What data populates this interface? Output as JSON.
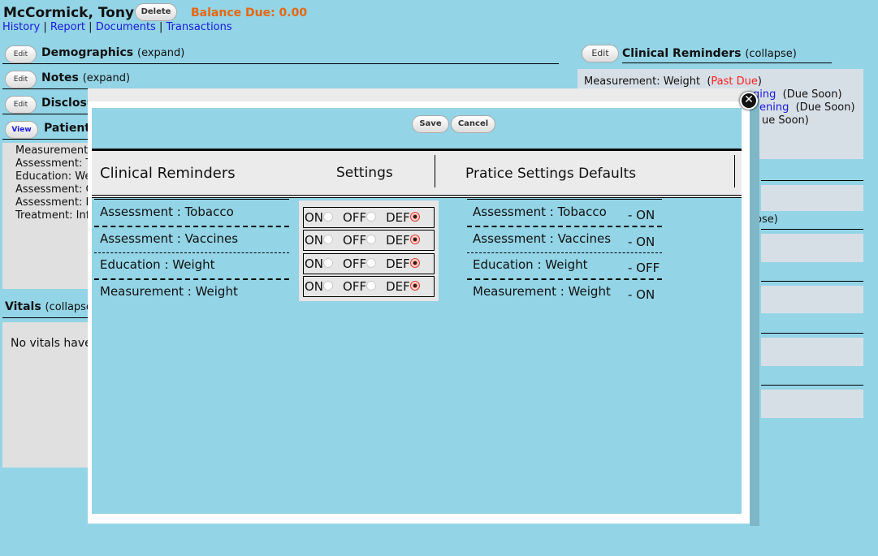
{
  "header": {
    "patient_name": "McCormick, Tony",
    "delete_label": "Delete",
    "balance": "Balance Due: 0.00",
    "links": [
      "History",
      "Report",
      "Documents",
      "Transactions"
    ],
    "separator": "|"
  },
  "sections": [
    {
      "button": "Edit",
      "title": "Demographics",
      "toggle": "(expand)"
    },
    {
      "button": "Edit",
      "title": "Notes",
      "toggle": "(expand)"
    },
    {
      "button": "Edit",
      "title": "Disclosu"
    },
    {
      "button": "View",
      "title": "Patient"
    }
  ],
  "left_items": [
    "Measurement",
    "Assessment: T",
    "Education: We",
    "Assessment: C",
    "Assessment: F",
    "Treatment: Inf"
  ],
  "vitals": {
    "title": "Vitals",
    "toggle": "(collapse",
    "message": "No vitals have"
  },
  "right": {
    "button": "Edit",
    "title": "Clinical Reminders",
    "toggle": "(collapse)",
    "first": {
      "text": "Measurement: Weight",
      "status": "Past Due"
    },
    "fragments": [
      {
        "link": "ging",
        "status": "(Due Soon)"
      },
      {
        "link": "eening",
        "status": "(Due Soon)"
      },
      {
        "link": "",
        "status": "ue Soon)"
      }
    ],
    "partial_toggle": "ose)"
  },
  "colors": {
    "background": "#93d4e6",
    "balance": "#e8670c",
    "past_due": "#ff2020",
    "link": "#1a1adb"
  },
  "modal": {
    "save": "Save",
    "cancel": "Cancel",
    "headers": {
      "reminders": "Clinical Reminders",
      "settings": "Settings",
      "defaults": "Pratice Settings Defaults"
    },
    "options": [
      "ON",
      "OFF",
      "DEF"
    ],
    "rows": [
      {
        "name": "Assessment : Tobacco",
        "selected": "DEF",
        "default": "- ON"
      },
      {
        "name": "Assessment : Vaccines",
        "selected": "DEF",
        "default": "- ON"
      },
      {
        "name": "Education : Weight",
        "selected": "DEF",
        "default": "- OFF"
      },
      {
        "name": "Measurement : Weight",
        "selected": "DEF",
        "default": "- ON"
      }
    ]
  }
}
